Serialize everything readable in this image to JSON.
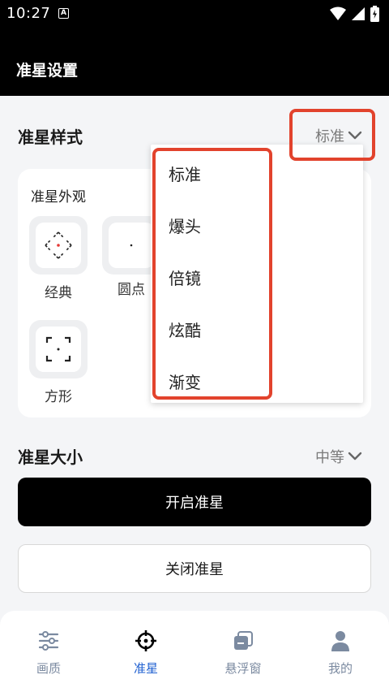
{
  "status_bar": {
    "time": "10:27",
    "notification_badge": "A",
    "icons": [
      "wifi-icon",
      "signal-icon",
      "battery-icon"
    ]
  },
  "app_bar": {
    "title": "准星设置"
  },
  "crosshair_style": {
    "title": "准星样式",
    "selected": "标准",
    "options": [
      "标准",
      "爆头",
      "倍镜",
      "炫酷",
      "渐变"
    ]
  },
  "appearance": {
    "title": "准星外观",
    "options": [
      "经典",
      "圆点",
      "方形"
    ]
  },
  "crosshair_size": {
    "title": "准星大小",
    "selected": "中等"
  },
  "buttons": {
    "enable": "开启准星",
    "disable": "关闭准星"
  },
  "bottom_nav": {
    "items": [
      {
        "label": "画质",
        "icon": "sliders-icon",
        "active": false
      },
      {
        "label": "准星",
        "icon": "crosshair-icon",
        "active": true
      },
      {
        "label": "悬浮窗",
        "icon": "floating-window-icon",
        "active": false
      },
      {
        "label": "我的",
        "icon": "profile-icon",
        "active": false
      }
    ]
  },
  "colors": {
    "accent": "#1e5fd0",
    "highlight": "#e2432d",
    "crosshair_dot": "#e53935",
    "app_bar": "#000000"
  }
}
